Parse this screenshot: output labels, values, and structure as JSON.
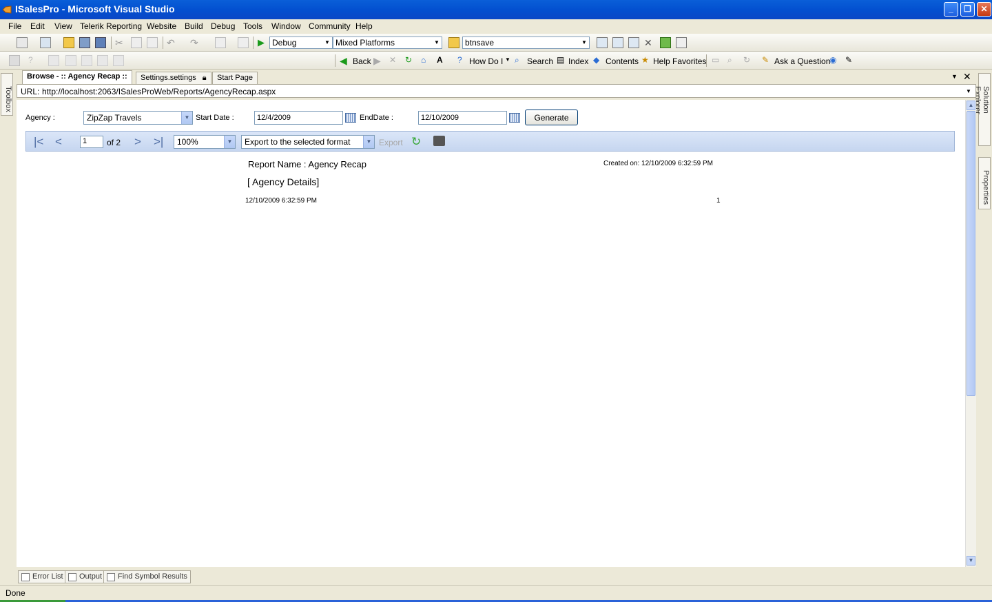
{
  "window": {
    "title": "ISalesPro - Microsoft Visual Studio"
  },
  "menu": [
    "File",
    "Edit",
    "View",
    "Telerik Reporting",
    "Website",
    "Build",
    "Debug",
    "Tools",
    "Window",
    "Community",
    "Help"
  ],
  "toolbar": {
    "config": "Debug",
    "platform": "Mixed Platforms",
    "find": "btnsave"
  },
  "webtoolbar": {
    "back": "Back",
    "howdoi": "How Do I",
    "search": "Search",
    "index": "Index",
    "contents": "Contents",
    "favorites": "Help Favorites",
    "ask": "Ask a Question"
  },
  "side": {
    "toolbox": "Toolbox",
    "solution_explorer": "Solution Explorer",
    "properties": "Properties"
  },
  "doc_tabs": [
    "Browse - :: Agency Recap ::",
    "Settings.settings",
    "Start Page"
  ],
  "url": {
    "label": "URL:",
    "value": "http://localhost:2063/ISalesProWeb/Reports/AgencyRecap.aspx"
  },
  "form": {
    "agency_label": "Agency :",
    "agency_value": "ZipZap Travels",
    "start_label": "Start Date :",
    "start_value": "12/4/2009",
    "end_label": "EndDate :",
    "end_value": "12/10/2009",
    "generate": "Generate"
  },
  "viewer": {
    "page": "1",
    "of": "of 2",
    "zoom": "100%",
    "export_format": "Export to the selected format",
    "export": "Export"
  },
  "report": {
    "name": "Report Name : Agency Recap",
    "created": "Created on: 12/10/2009 6:32:59 PM",
    "section": "[ Agency Details]",
    "footer_date": "12/10/2009 6:32:59 PM",
    "page_num": "1"
  },
  "bottom_tabs": [
    "Error List",
    "Output",
    "Find Symbol Results"
  ],
  "status": "Done"
}
